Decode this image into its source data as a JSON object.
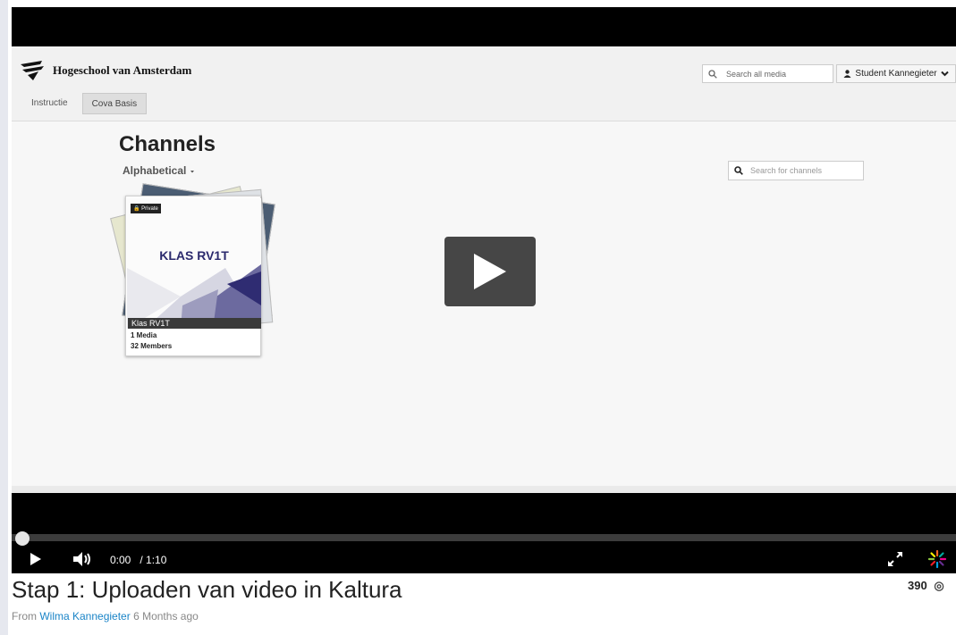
{
  "site": {
    "logo_text": "Hogeschool van Amsterdam",
    "nav": [
      "Instructie",
      "Cova Basis"
    ],
    "search_placeholder": "Search all media",
    "user_label": "Student Kannegieter"
  },
  "channels": {
    "title": "Channels",
    "sort_label": "Alphabetical",
    "search_placeholder": "Search for channels",
    "card": {
      "badge": "Private",
      "thumb_title": "KLAS RV1T",
      "caption": "Klas RV1T",
      "media": "1 Media",
      "members": "32 Members"
    }
  },
  "player": {
    "current_time": "0:00",
    "duration": "/ 1:10",
    "progress": 0
  },
  "video": {
    "title": "Stap 1: Uploaden van video in Kaltura",
    "from_prefix": "From",
    "author": "Wilma Kannegieter",
    "age": "6 Months ago",
    "views": "390"
  },
  "colors": {
    "link": "#1a84c7",
    "klas_title": "#2b2a6d"
  }
}
